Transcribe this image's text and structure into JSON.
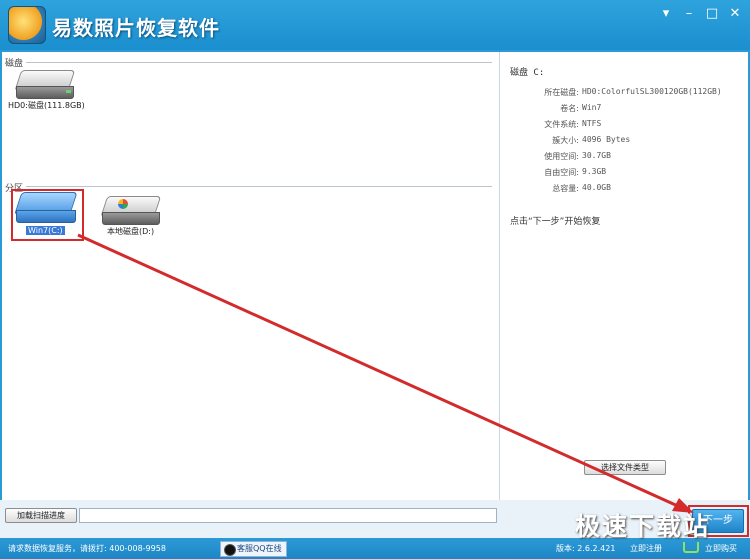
{
  "app": {
    "title": "易数照片恢复软件",
    "minimize": "–",
    "maximize": "□",
    "close": "✕",
    "extra": "▾"
  },
  "left": {
    "disk_section": "磁盘",
    "partition_section": "分区",
    "disk_caption": "HD0:磁盘(111.8GB)",
    "partitions": [
      {
        "caption": "Win7(C:)",
        "selected": true
      },
      {
        "caption": "本地磁盘(D:)",
        "selected": false
      }
    ]
  },
  "info": {
    "title": "磁盘 C:",
    "rows": [
      {
        "key": "所在磁盘:",
        "value": "HD0:ColorfulSL300120GB(112GB)"
      },
      {
        "key": "卷名:",
        "value": "Win7"
      },
      {
        "key": "文件系统:",
        "value": "NTFS"
      },
      {
        "key": "簇大小:",
        "value": "4096 Bytes"
      },
      {
        "key": "使用空间:",
        "value": "30.7GB"
      },
      {
        "key": "自由空间:",
        "value": "9.3GB"
      },
      {
        "key": "总容量:",
        "value": "40.0GB"
      }
    ],
    "hint": "点击“下一步”开始恢复",
    "select_type_button": "选择文件类型"
  },
  "bottom": {
    "load_progress_button": "加载扫描进度",
    "next_button": "下一步"
  },
  "status": {
    "service": "请求数据恢复服务，请拨打: 400-008-9958",
    "qq": "客服QQ在线",
    "version": "版本: 2.6.2.421",
    "register": "立即注册",
    "buy": "立即购买"
  },
  "watermark": "极速下载站",
  "colors": {
    "accent": "#2a9ad6",
    "annotation": "#d32b2b",
    "selection": "#3a78d6"
  }
}
